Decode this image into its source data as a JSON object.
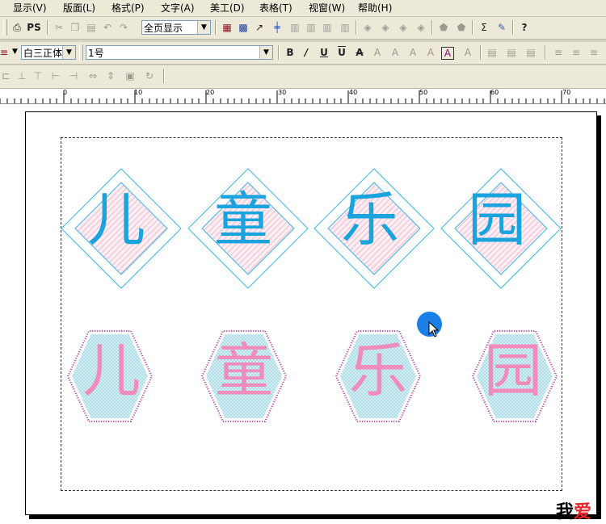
{
  "menu": [
    "显示(V)",
    "版面(L)",
    "格式(P)",
    "文字(A)",
    "美工(D)",
    "表格(T)",
    "视窗(W)",
    "帮助(H)"
  ],
  "toolbar1": {
    "ps_label": "PS",
    "view_select": "全页显示"
  },
  "toolbar2": {
    "font_name": "白三正体",
    "font_size": "1号"
  },
  "ruler_ticks": [
    "0",
    "10",
    "20",
    "30",
    "40",
    "50",
    "60",
    "70"
  ],
  "diamonds": {
    "chars": [
      "儿",
      "童",
      "乐",
      "园"
    ],
    "text_color": "#1aa3dc",
    "outline_color": "#3bb6e0",
    "fill_color": "#f2b8cc"
  },
  "hexagons": {
    "chars": [
      "儿",
      "童",
      "乐",
      "园"
    ],
    "text_color": "#f08cbc",
    "outline_color": "#b0208a",
    "fill_color": "#a9dbe6"
  },
  "watermark": {
    "black": "我",
    "red": "爱"
  }
}
